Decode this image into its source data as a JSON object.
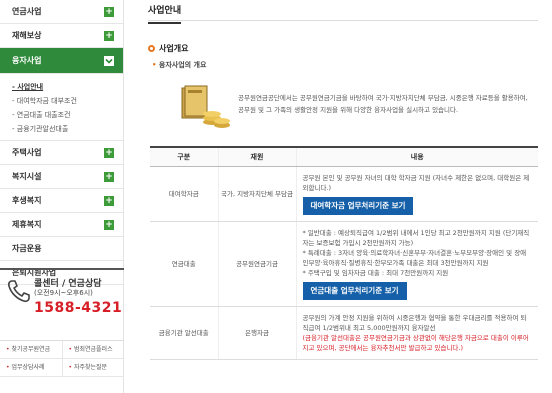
{
  "sidebar": {
    "items": [
      {
        "label": "연금사업",
        "icon": "+"
      },
      {
        "label": "재해보상",
        "icon": "+"
      },
      {
        "label": "융자사업",
        "icon": "+"
      },
      {
        "label": "주택사업",
        "icon": "+"
      },
      {
        "label": "복지시설",
        "icon": "+"
      },
      {
        "label": "후생복지",
        "icon": "+"
      },
      {
        "label": "제휴복지",
        "icon": "+"
      },
      {
        "label": "자금운용"
      },
      {
        "label": "은퇴지원사업"
      }
    ],
    "submenu": [
      "- 사업안내",
      "- 대여학자금 대부조건",
      "- 연금대출 대출조건",
      "- 금융기관알선대출"
    ]
  },
  "callcenter": {
    "title": "콜센터 / 연금상담",
    "hours": "(오전9시~오후6시)",
    "number": "1588-4321"
  },
  "quicklinks": [
    "찾기공무원연금",
    "범죄연금플러스",
    "업무상담사례",
    "자주찾는질문"
  ],
  "main": {
    "page_title": "사업안내",
    "section_title": "사업개요",
    "sub_title": "융자사업의 개요",
    "intro": "공무원연금공단에서는 공무원연금기금을 바탕하여 국가·지방자치단체 부담금, 시중은행 자료등을 활용하여, 공무원 및 그 가족의 생활안정 지원을 위해 다양한 융자사업을 실시하고 있습니다."
  },
  "table": {
    "headers": [
      "구분",
      "재원",
      "내용"
    ],
    "rows": [
      {
        "category": "대여학자금",
        "source": "국가, 지방자치단체 부담금",
        "content": [
          "공무원 본인 및 공무원 자녀의 대학 학자금 지원 (자녀수 제한은 없으며, 대학원은 제외합니다.)"
        ],
        "button": "대여학자금 업무처리기준 보기"
      },
      {
        "category": "연금대출",
        "source": "공무원연금기금",
        "content": [
          "* 일반대출 : 예상퇴직급여 1/2범위 내에서 1인당 최고 2천만원까지 지원 (단기재직자는 보증보험 가입시 2천만원까지 가능)",
          "* 특례대출 : 3자녀 양육·의료학자녀·신혼부부·자녀결혼·노부모부양·장애인 및 장애인부양·육아휴직·질병휴직·한부모가족 대출은 최대 3천만원까지 지원",
          "* 주택구입 및 임차자금 대출 : 최대 7천만원까지 지원"
        ],
        "button": "연금대출 업무처리기준 보기"
      },
      {
        "category": "금융기관 알선대출",
        "source": "은행자금",
        "content": [
          "공무원의 가계 안정 지원을 위하여 시중은행과 협약을 통한 우대금리를 적용하여 퇴직급여 1/2범위내 최고 5,000만원까지 융자알선"
        ],
        "note": "(금융기관 알선대출은 공무원연금기금과 상관없이 해당은행 자금으로 대출이 이루어지고 있으며, 공단에서는 융자추천서만 발급하고 있습니다.)"
      }
    ]
  },
  "colors": {
    "green": "#2f8a3b",
    "plus_green": "#3e9b3a",
    "red": "#d61f26",
    "blue_button": "#1560a8",
    "orange": "#e87722"
  }
}
